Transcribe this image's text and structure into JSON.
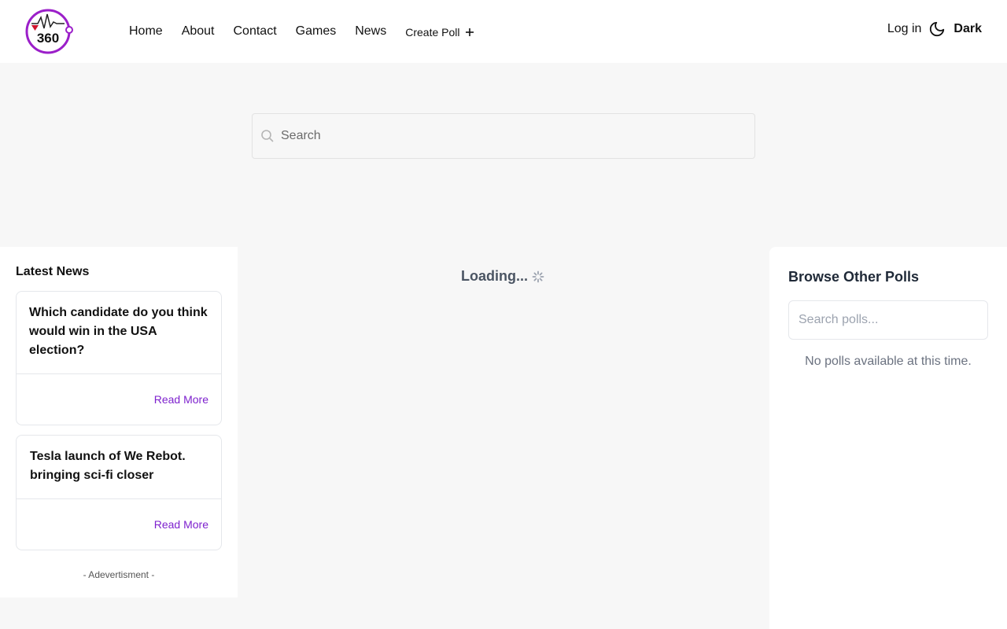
{
  "brand": {
    "logo_icon": "waveform-360-logo-icon",
    "logo_text": "360",
    "accent_color": "#7e22ce",
    "logo_ring_color": "#9b1fc9"
  },
  "nav": {
    "items": [
      {
        "label": "Home"
      },
      {
        "label": "About"
      },
      {
        "label": "Contact"
      },
      {
        "label": "Games"
      },
      {
        "label": "News"
      }
    ],
    "create_poll_label": "Create Poll",
    "create_poll_icon": "plus-icon"
  },
  "header_right": {
    "login_label": "Log in",
    "theme_icon": "moon-icon",
    "theme_label": "Dark"
  },
  "search": {
    "icon": "search-icon",
    "placeholder": "Search",
    "value": ""
  },
  "latest_news": {
    "title": "Latest News",
    "articles": [
      {
        "title": "Which candidate do you think would win in the USA election?",
        "read_more_label": "Read More"
      },
      {
        "title": "Tesla launch of We Rebot. bringing sci-fi closer",
        "read_more_label": "Read More"
      }
    ],
    "advertisement_label": "- Adevertisment -"
  },
  "main": {
    "loading_text": "Loading...",
    "loading_icon": "spinner-icon"
  },
  "browse_polls": {
    "title": "Browse Other Polls",
    "search_placeholder": "Search polls...",
    "search_value": "",
    "empty_message": "No polls available at this time."
  }
}
